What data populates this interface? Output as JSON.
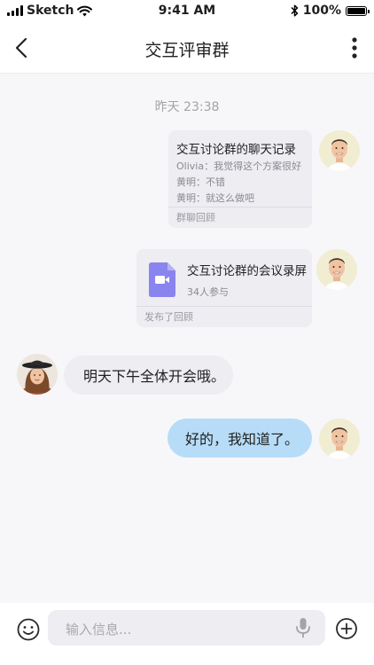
{
  "status_bar": {
    "carrier": "Sketch",
    "time": "9:41 AM",
    "battery": "100%"
  },
  "nav": {
    "title": "交互评审群"
  },
  "chat": {
    "timestamp": "昨天 23:38",
    "history_card": {
      "title": "交互讨论群的聊天记录",
      "lines": [
        "Olivia：我觉得这个方案很好",
        "黄明：不错",
        "黄明：就这么做吧"
      ],
      "footer": "群聊回顾"
    },
    "recording_card": {
      "title": "交互讨论群的会议录屏",
      "participants": "34人参与",
      "footer": "发布了回顾"
    },
    "incoming_message": "明天下午全体开会哦。",
    "outgoing_message": "好的，我知道了。"
  },
  "input": {
    "placeholder": "输入信息..."
  },
  "icons": {
    "back": "chevron-left-icon",
    "more": "more-vertical-icon",
    "emoji": "smiley-icon",
    "voice": "microphone-icon",
    "add": "plus-circle-icon",
    "video": "video-file-icon"
  },
  "colors": {
    "accent": "#b7dcf7",
    "incoming_bubble": "#ededf2",
    "card_bg": "#ededf2",
    "video_icon": "#8a84ef"
  }
}
